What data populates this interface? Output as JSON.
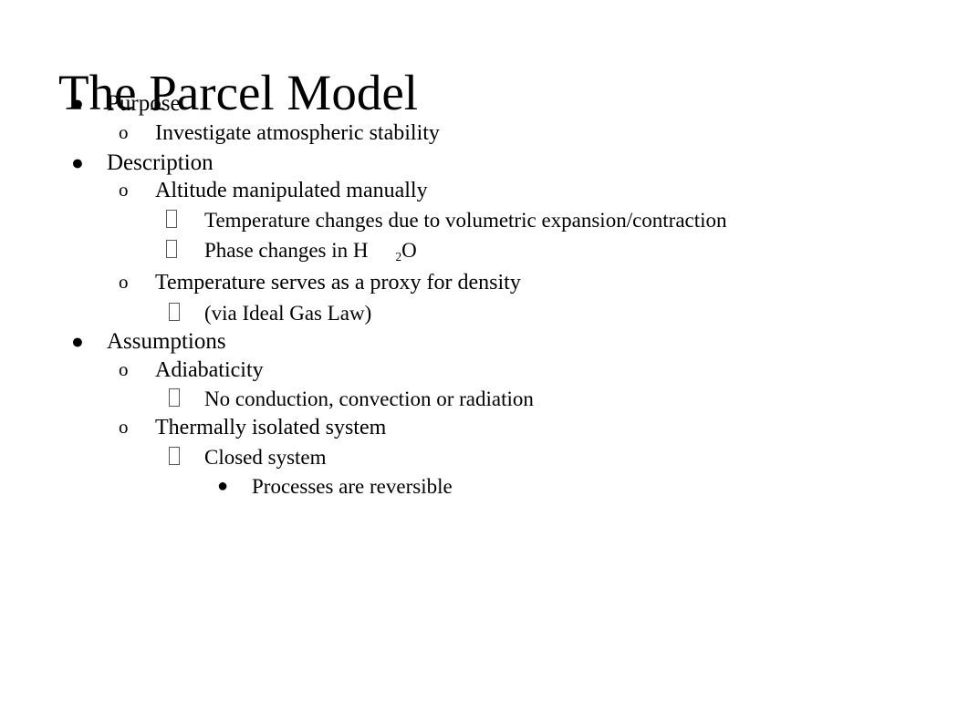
{
  "slide": {
    "title": "The Parcel Model",
    "background_color": "#ffffff",
    "text_color": "#000000",
    "tofu_border_color": "#595959",
    "markers": {
      "level1": "●",
      "level2": "o",
      "level3": "□",
      "level4": "●"
    },
    "bullets": [
      {
        "level": 1,
        "text": "Purpose"
      },
      {
        "level": 2,
        "text": "Investigate atmospheric stability"
      },
      {
        "level": 1,
        "text": "Description"
      },
      {
        "level": 2,
        "text": "Altitude manipulated manually"
      },
      {
        "level": 3,
        "text": "Temperature changes due to volumetric expansion/contraction"
      },
      {
        "level": 3,
        "text": "Phase changes in H",
        "formula": {
          "prefix": "Phase changes in H",
          "subscript": "2",
          "suffix": "O"
        }
      },
      {
        "level": 2,
        "text": "Temperature serves as a proxy for density"
      },
      {
        "level": 3,
        "text": "(via Ideal Gas Law)"
      },
      {
        "level": 1,
        "text": "Assumptions"
      },
      {
        "level": 2,
        "text": "Adiabaticity"
      },
      {
        "level": 3,
        "text": "No conduction, convection or radiation"
      },
      {
        "level": 2,
        "text": "Thermally isolated system"
      },
      {
        "level": 3,
        "text": "Closed system"
      },
      {
        "level": 4,
        "text": "Processes are reversible"
      }
    ]
  }
}
